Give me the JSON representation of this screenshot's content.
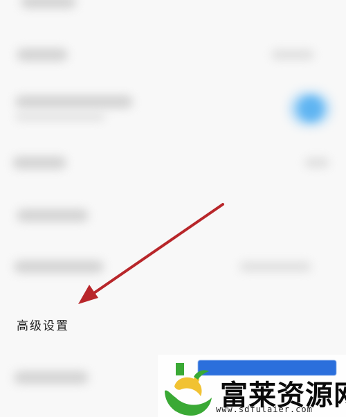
{
  "settings": {
    "advanced_label": "高级设置"
  },
  "watermark": {
    "brand": "富莱资源网",
    "url": "www.sdfulaier.com"
  },
  "colors": {
    "background": "#f8f8f8",
    "toggle_blue": "#5fb4f1",
    "arrow_red": "#b8262a",
    "watermark_green": "#3aa935",
    "watermark_yellow": "#f1c232",
    "watermark_blue": "#2b6fdc"
  },
  "icons": {
    "arrow": "red-arrow-pointer-icon",
    "logo": "leaf-globe-logo-icon"
  }
}
